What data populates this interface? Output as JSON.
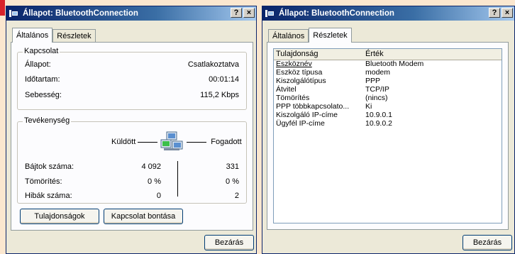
{
  "left_window": {
    "title": "Állapot: BluetoothConnection",
    "help_label": "?",
    "close_label": "×",
    "tabs": [
      {
        "label": "Általános"
      },
      {
        "label": "Részletek"
      }
    ],
    "connection": {
      "title": "Kapcsolat",
      "rows": [
        {
          "label": "Állapot:",
          "value": "Csatlakoztatva"
        },
        {
          "label": "Időtartam:",
          "value": "00:01:14"
        },
        {
          "label": "Sebesség:",
          "value": "115,2 Kbps"
        }
      ]
    },
    "activity": {
      "title": "Tevékenység",
      "sent_label": "Küldött",
      "received_label": "Fogadott",
      "rows": [
        {
          "label": "Bájtok száma:",
          "sent": "4 092",
          "received": "331"
        },
        {
          "label": "Tömörítés:",
          "sent": "0 %",
          "received": "0 %"
        },
        {
          "label": "Hibák száma:",
          "sent": "0",
          "received": "2"
        }
      ]
    },
    "buttons": {
      "properties": "Tulajdonságok",
      "disconnect": "Kapcsolat bontása",
      "close": "Bezárás"
    }
  },
  "right_window": {
    "title": "Állapot: BluetoothConnection",
    "help_label": "?",
    "close_label": "×",
    "tabs": [
      {
        "label": "Általános"
      },
      {
        "label": "Részletek"
      }
    ],
    "table": {
      "headers": {
        "property": "Tulajdonság",
        "value": "Érték"
      },
      "rows": [
        {
          "property": "Eszköznév",
          "value": "Bluetooth Modem"
        },
        {
          "property": "Eszköz típusa",
          "value": "modem"
        },
        {
          "property": "Kiszolgálótípus",
          "value": "PPP"
        },
        {
          "property": "Átvitel",
          "value": "TCP/IP"
        },
        {
          "property": "Tömörítés",
          "value": "(nincs)"
        },
        {
          "property": "PPP többkapcsolato...",
          "value": "Ki"
        },
        {
          "property": "Kiszolgáló IP-címe",
          "value": "10.9.0.1"
        },
        {
          "property": "Ügyfél IP-címe",
          "value": "10.9.0.2"
        }
      ]
    },
    "buttons": {
      "close": "Bezárás"
    }
  }
}
